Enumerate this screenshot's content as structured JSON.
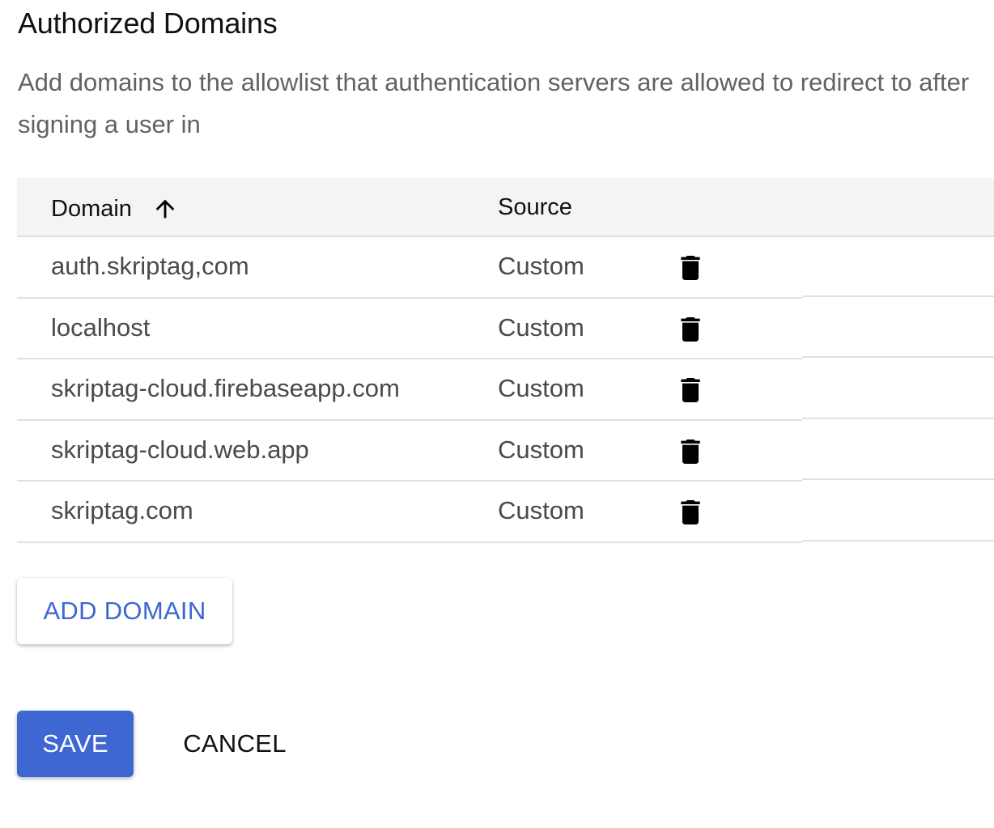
{
  "header": {
    "title": "Authorized Domains",
    "description": "Add domains to the allowlist that authentication servers are allowed to redirect to after signing a user in"
  },
  "table": {
    "columns": {
      "domain": "Domain",
      "source": "Source"
    },
    "sort_icon": "arrow-upward-icon",
    "rows": [
      {
        "domain": "auth.skriptag,com",
        "source": "Custom",
        "action_icon": "trash-icon"
      },
      {
        "domain": "localhost",
        "source": "Custom",
        "action_icon": "trash-icon"
      },
      {
        "domain": "skriptag-cloud.firebaseapp.com",
        "source": "Custom",
        "action_icon": "trash-icon"
      },
      {
        "domain": "skriptag-cloud.web.app",
        "source": "Custom",
        "action_icon": "trash-icon"
      },
      {
        "domain": "skriptag.com",
        "source": "Custom",
        "action_icon": "trash-icon"
      }
    ]
  },
  "actions": {
    "add_domain_label": "ADD DOMAIN",
    "save_label": "SAVE",
    "cancel_label": "CANCEL"
  },
  "colors": {
    "primary": "#3f67d2",
    "link_text": "#3b67d1",
    "header_bg": "#f4f4f4",
    "divider": "#e0e0e0"
  }
}
